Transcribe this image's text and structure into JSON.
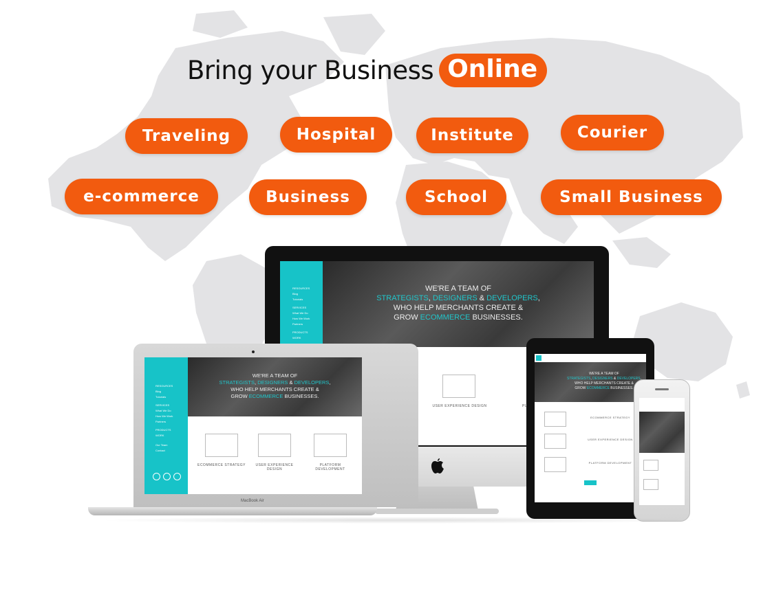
{
  "headline": {
    "text": "Bring your Business",
    "highlight": "Online"
  },
  "categories": [
    "Traveling",
    "Hospital",
    "Institute",
    "Courier",
    "e-commerce",
    "Business",
    "School",
    "Small Business"
  ],
  "site": {
    "hero_line1": "WE'RE A TEAM OF",
    "hero_t1": "STRATEGISTS",
    "hero_sep1": ", ",
    "hero_t2": "DESIGNERS",
    "hero_sep2": " & ",
    "hero_t3": "DEVELOPERS",
    "hero_sep3": ",",
    "hero_line3": "WHO HELP MERCHANTS CREATE &",
    "hero_line4a": "GROW ",
    "hero_t4": "ECOMMERCE",
    "hero_line4b": " BUSINESSES.",
    "nav": [
      "RESOURCES",
      "Blog",
      "Tutorials",
      "SERVICES",
      "What We Do",
      "How We Work",
      "Partners",
      "PRODUCTS",
      "WORK",
      "Our Team",
      "Contact",
      "Contact"
    ],
    "card1": "ECOMMERCE STRATEGY",
    "card2": "USER EXPERIENCE DESIGN",
    "card3": "PLATFORM DEVELOPMENT",
    "laptop_label": "MacBook Air"
  },
  "colors": {
    "accent": "#f25b0f",
    "teal": "#17c3c8",
    "map": "#e4e4e6"
  }
}
